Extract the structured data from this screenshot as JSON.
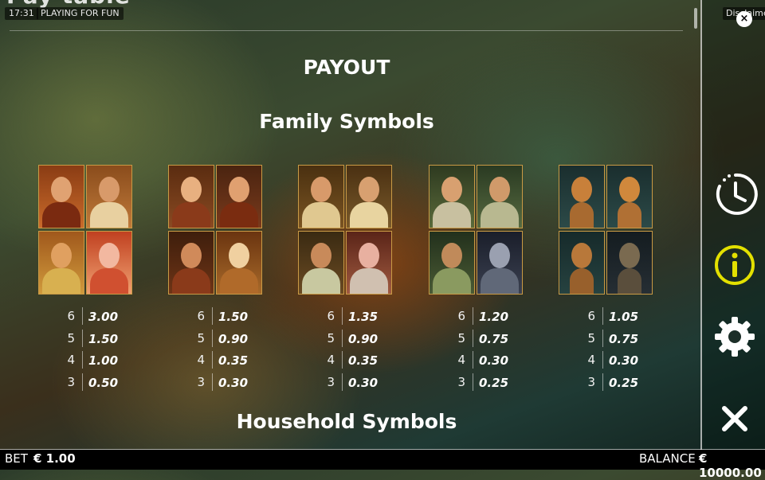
{
  "header": {
    "title_fragment": "Pay table",
    "time": "17:31",
    "mode": "PLAYING FOR FUN",
    "disclaimer": "Disclaimer"
  },
  "paytable": {
    "title": "PAYOUT",
    "family_title": "Family Symbols",
    "household_title": "Household Symbols",
    "groups": [
      {
        "name": "father",
        "pays": [
          {
            "count": "6",
            "value": "3.00"
          },
          {
            "count": "5",
            "value": "1.50"
          },
          {
            "count": "4",
            "value": "1.00"
          },
          {
            "count": "3",
            "value": "0.50"
          }
        ]
      },
      {
        "name": "mother",
        "pays": [
          {
            "count": "6",
            "value": "1.50"
          },
          {
            "count": "5",
            "value": "0.90"
          },
          {
            "count": "4",
            "value": "0.35"
          },
          {
            "count": "3",
            "value": "0.30"
          }
        ]
      },
      {
        "name": "son",
        "pays": [
          {
            "count": "6",
            "value": "1.35"
          },
          {
            "count": "5",
            "value": "0.90"
          },
          {
            "count": "4",
            "value": "0.35"
          },
          {
            "count": "3",
            "value": "0.30"
          }
        ]
      },
      {
        "name": "daughter",
        "pays": [
          {
            "count": "6",
            "value": "1.20"
          },
          {
            "count": "5",
            "value": "0.75"
          },
          {
            "count": "4",
            "value": "0.30"
          },
          {
            "count": "3",
            "value": "0.25"
          }
        ]
      },
      {
        "name": "dog",
        "pays": [
          {
            "count": "6",
            "value": "1.05"
          },
          {
            "count": "5",
            "value": "0.75"
          },
          {
            "count": "4",
            "value": "0.30"
          },
          {
            "count": "3",
            "value": "0.25"
          }
        ]
      }
    ]
  },
  "side_menu": {
    "icons": [
      "history-icon",
      "info-icon",
      "settings-icon",
      "close-icon"
    ],
    "info_color": "#e3e000"
  },
  "footer": {
    "bet_label": "BET",
    "bet_value": "€ 1.00",
    "balance_label": "BALANCE",
    "balance_value": "€ 10000.00"
  }
}
